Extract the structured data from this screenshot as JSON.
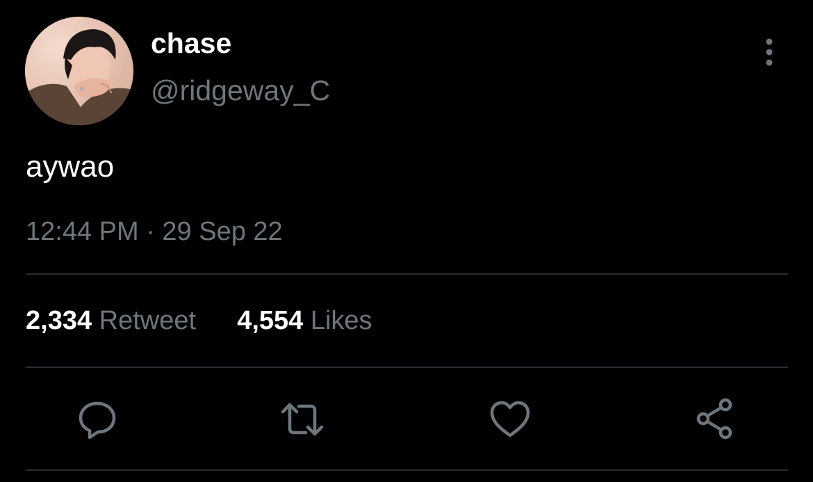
{
  "tweet": {
    "display_name": "chase",
    "handle": "@ridgeway_C",
    "text": "aywao",
    "timestamp": "12:44 PM · 29 Sep 22",
    "stats": {
      "retweets_count": "2,334",
      "retweets_label": "Retweet",
      "likes_count": "4,554",
      "likes_label": "Likes"
    }
  },
  "actions": [
    {
      "name": "reply-icon"
    },
    {
      "name": "retweet-icon"
    },
    {
      "name": "like-icon"
    },
    {
      "name": "share-icon"
    }
  ],
  "colors": {
    "background": "#000000",
    "text_primary": "#ffffff",
    "text_secondary": "#6e767d",
    "divider": "#2a2d31"
  }
}
